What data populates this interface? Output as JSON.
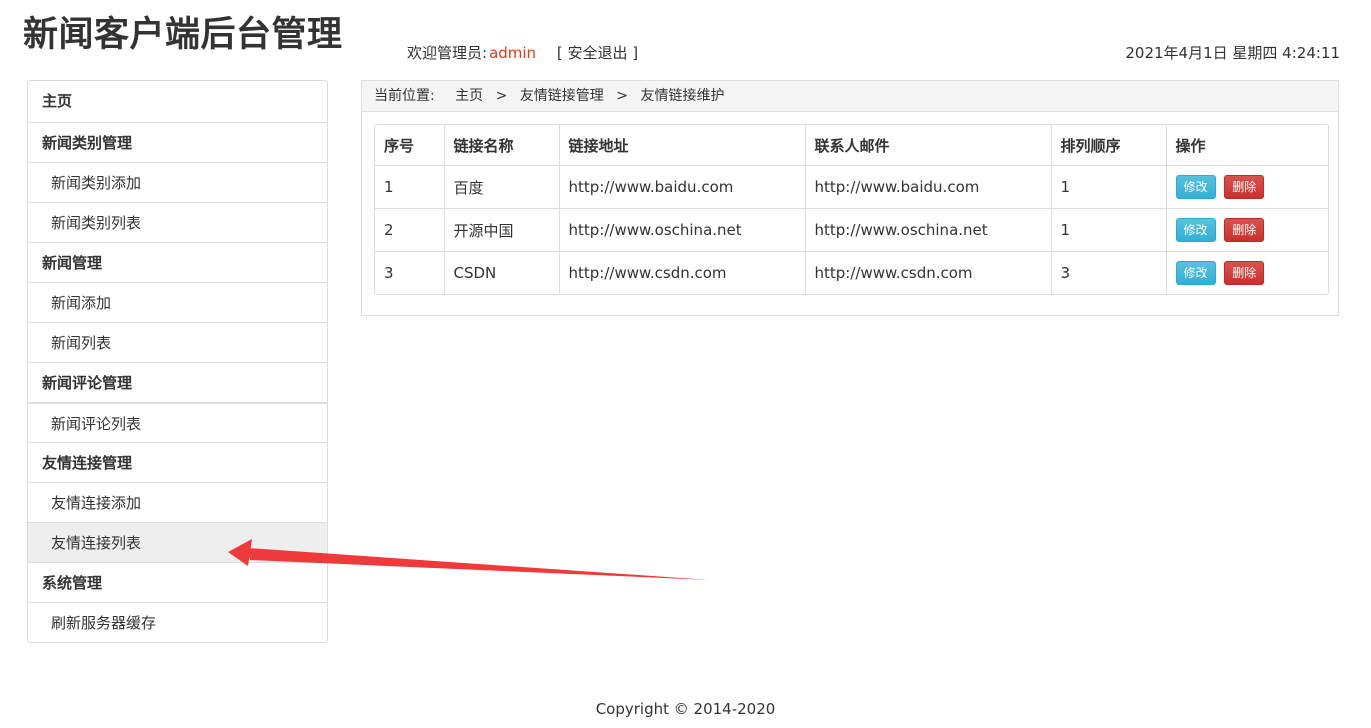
{
  "header": {
    "title": "新闻客户端后台管理",
    "welcome_label": "欢迎管理员:",
    "username": "admin",
    "logout_label": "[ 安全退出 ]",
    "datetime": "2021年4月1日 星期四 4:24:11"
  },
  "sidebar": {
    "items": [
      {
        "label": "主页"
      },
      {
        "label": "新闻类别管理"
      },
      {
        "label": "新闻类别添加"
      },
      {
        "label": "新闻类别列表"
      },
      {
        "label": "新闻管理"
      },
      {
        "label": "新闻添加"
      },
      {
        "label": "新闻列表"
      },
      {
        "label": "新闻评论管理"
      },
      {
        "label": "新闻评论列表"
      },
      {
        "label": "友情连接管理"
      },
      {
        "label": "友情连接添加"
      },
      {
        "label": "友情连接列表"
      },
      {
        "label": "系统管理"
      },
      {
        "label": "刷新服务器缓存"
      }
    ]
  },
  "breadcrumb": {
    "label": "当前位置:",
    "items": [
      "主页",
      "友情链接管理",
      "友情链接维护"
    ],
    "separator": ">"
  },
  "table": {
    "headers": [
      "序号",
      "链接名称",
      "链接地址",
      "联系人邮件",
      "排列顺序",
      "操作"
    ],
    "rows": [
      [
        "1",
        "百度",
        "http://www.baidu.com",
        "http://www.baidu.com",
        "1"
      ],
      [
        "2",
        "开源中国",
        "http://www.oschina.net",
        "http://www.oschina.net",
        "1"
      ],
      [
        "3",
        "CSDN",
        "http://www.csdn.com",
        "http://www.csdn.com",
        "3"
      ]
    ],
    "edit_label": "修改",
    "delete_label": "删除"
  },
  "footer": {
    "copyright": "Copyright © 2014-2020"
  },
  "colors": {
    "accent_user": "#e0391a",
    "edit_button": "#31b0d5",
    "delete_button": "#d9534f",
    "annotation_arrow": "#ee3a3a"
  }
}
